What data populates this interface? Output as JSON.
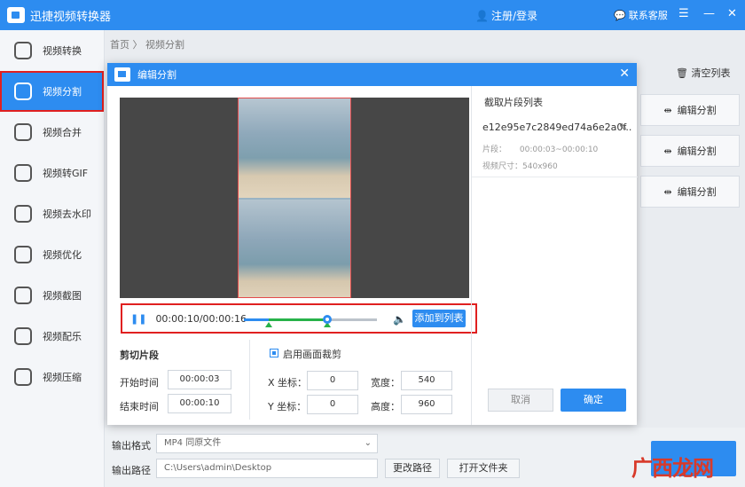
{
  "app": {
    "title": "迅捷视频转换器",
    "login": "注册/登录",
    "service": "联系客服",
    "controls": [
      "☰",
      "—",
      "✕"
    ]
  },
  "sidebar": {
    "items": [
      {
        "label": "视频转换",
        "icon": "convert-icon"
      },
      {
        "label": "视频分割",
        "icon": "split-icon"
      },
      {
        "label": "视频合并",
        "icon": "merge-icon"
      },
      {
        "label": "视频转GIF",
        "icon": "gif-icon"
      },
      {
        "label": "视频去水印",
        "icon": "watermark-remove-icon"
      },
      {
        "label": "视频优化",
        "icon": "optimize-icon"
      },
      {
        "label": "视频截图",
        "icon": "screenshot-icon"
      },
      {
        "label": "视频配乐",
        "icon": "music-icon"
      },
      {
        "label": "视频压缩",
        "icon": "compress-icon"
      }
    ],
    "active_index": 1
  },
  "breadcrumb": {
    "home": "首页",
    "sep": "〉",
    "current": "视频分割"
  },
  "right": {
    "clear_list": "清空列表",
    "edit_split": "编辑分割"
  },
  "bottom": {
    "format_label": "输出格式",
    "format_value": "MP4  同原文件",
    "path_label": "输出路径",
    "path_value": "C:\\Users\\admin\\Desktop",
    "change_path": "更改路径",
    "open_folder": "打开文件夹"
  },
  "watermark": "广西龙网",
  "dialog": {
    "title": "编辑分割",
    "player": {
      "timecode": "00:00:10/00:00:16",
      "progress": 0.625,
      "selection_start": 0.1875,
      "selection_end": 0.625,
      "add_button": "添加到列表"
    },
    "clip_section": {
      "title": "剪切片段",
      "start_label": "开始时间",
      "start_value": "00:00:03",
      "end_label": "结束时间",
      "end_value": "00:00:10"
    },
    "crop_section": {
      "enabled_label": "启用画面裁剪",
      "x_label": "X 坐标：",
      "x_value": "0",
      "y_label": "Y 坐标：",
      "y_value": "0",
      "width_label": "宽度：",
      "width_value": "540",
      "height_label": "高度：",
      "height_value": "960"
    },
    "list": {
      "title": "截取片段列表",
      "clip_name": "e12e95e7c2849ed74a6e2a0f..",
      "segment_label": "片段：",
      "segment_value": "00:00:03~00:00:10",
      "size_label": "视频尺寸：",
      "size_value": "540x960"
    },
    "cancel": "取消",
    "ok": "确定"
  }
}
